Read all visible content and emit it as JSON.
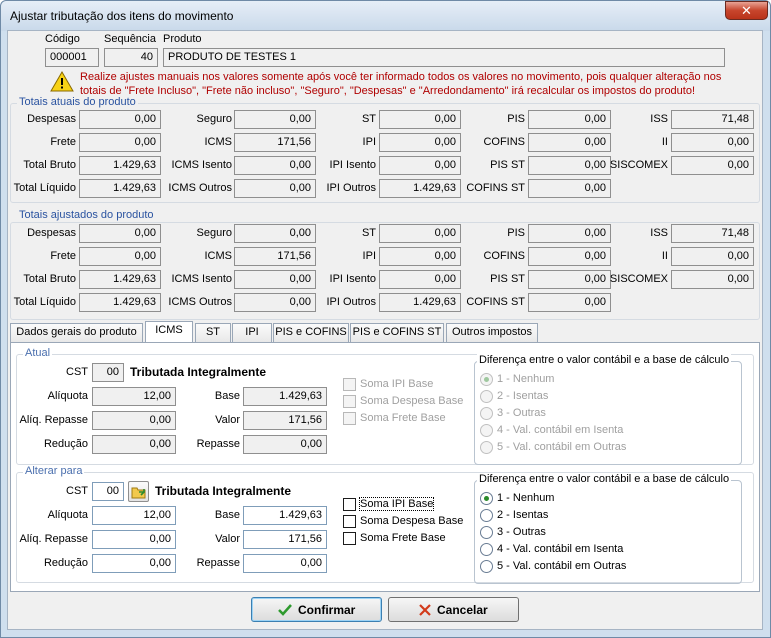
{
  "window": {
    "title": "Ajustar tributação dos itens do movimento",
    "close_glyph": "✕"
  },
  "header": {
    "codigo_label": "Código",
    "codigo_value": "000001",
    "sequencia_label": "Sequência",
    "sequencia_value": "40",
    "produto_label": "Produto",
    "produto_value": "PRODUTO DE TESTES 1"
  },
  "warning": {
    "line1": "Realize ajustes manuais nos valores somente após você ter informado todos os valores no movimento, pois qualquer alteração nos",
    "line2": "totais de  \"Frete Incluso\", \"Frete não incluso\", \"Seguro\", \"Despesas\" e \"Arredondamento\" irá recalcular os impostos do produto!"
  },
  "totais_atuais": {
    "title": "Totais atuais do produto",
    "despesas": {
      "label": "Despesas",
      "value": "0,00"
    },
    "frete": {
      "label": "Frete",
      "value": "0,00"
    },
    "total_bruto": {
      "label": "Total Bruto",
      "value": "1.429,63"
    },
    "total_liquido": {
      "label": "Total Líquido",
      "value": "1.429,63"
    },
    "seguro": {
      "label": "Seguro",
      "value": "0,00"
    },
    "icms": {
      "label": "ICMS",
      "value": "171,56"
    },
    "icms_isento": {
      "label": "ICMS Isento",
      "value": "0,00"
    },
    "icms_outros": {
      "label": "ICMS Outros",
      "value": "0,00"
    },
    "st": {
      "label": "ST",
      "value": "0,00"
    },
    "ipi": {
      "label": "IPI",
      "value": "0,00"
    },
    "ipi_isento": {
      "label": "IPI Isento",
      "value": "0,00"
    },
    "ipi_outros": {
      "label": "IPI Outros",
      "value": "1.429,63"
    },
    "pis": {
      "label": "PIS",
      "value": "0,00"
    },
    "cofins": {
      "label": "COFINS",
      "value": "0,00"
    },
    "pis_st": {
      "label": "PIS ST",
      "value": "0,00"
    },
    "cofins_st": {
      "label": "COFINS ST",
      "value": "0,00"
    },
    "iss": {
      "label": "ISS",
      "value": "71,48"
    },
    "ii": {
      "label": "II",
      "value": "0,00"
    },
    "siscomex": {
      "label": "SISCOMEX",
      "value": "0,00"
    }
  },
  "totais_ajustados": {
    "title": "Totais ajustados do produto",
    "despesas": {
      "label": "Despesas",
      "value": "0,00"
    },
    "frete": {
      "label": "Frete",
      "value": "0,00"
    },
    "total_bruto": {
      "label": "Total Bruto",
      "value": "1.429,63"
    },
    "total_liquido": {
      "label": "Total Líquido",
      "value": "1.429,63"
    },
    "seguro": {
      "label": "Seguro",
      "value": "0,00"
    },
    "icms": {
      "label": "ICMS",
      "value": "171,56"
    },
    "icms_isento": {
      "label": "ICMS Isento",
      "value": "0,00"
    },
    "icms_outros": {
      "label": "ICMS Outros",
      "value": "0,00"
    },
    "st": {
      "label": "ST",
      "value": "0,00"
    },
    "ipi": {
      "label": "IPI",
      "value": "0,00"
    },
    "ipi_isento": {
      "label": "IPI Isento",
      "value": "0,00"
    },
    "ipi_outros": {
      "label": "IPI Outros",
      "value": "1.429,63"
    },
    "pis": {
      "label": "PIS",
      "value": "0,00"
    },
    "cofins": {
      "label": "COFINS",
      "value": "0,00"
    },
    "pis_st": {
      "label": "PIS ST",
      "value": "0,00"
    },
    "cofins_st": {
      "label": "COFINS ST",
      "value": "0,00"
    },
    "iss": {
      "label": "ISS",
      "value": "71,48"
    },
    "ii": {
      "label": "II",
      "value": "0,00"
    },
    "siscomex": {
      "label": "SISCOMEX",
      "value": "0,00"
    }
  },
  "tabs": [
    {
      "label": "Dados gerais do produto"
    },
    {
      "label": "ICMS",
      "active": true
    },
    {
      "label": "ST"
    },
    {
      "label": "IPI"
    },
    {
      "label": "PIS e COFINS"
    },
    {
      "label": "PIS e COFINS ST"
    },
    {
      "label": "Outros impostos"
    }
  ],
  "atual": {
    "title": "Atual",
    "cst_label": "CST",
    "cst_value": "00",
    "cst_desc": "Tributada Integralmente",
    "aliquota": {
      "label": "Alíquota",
      "value": "12,00"
    },
    "aliq_repasse": {
      "label": "Alíq. Repasse",
      "value": "0,00"
    },
    "reducao": {
      "label": "Redução",
      "value": "0,00"
    },
    "base": {
      "label": "Base",
      "value": "1.429,63"
    },
    "valor": {
      "label": "Valor",
      "value": "171,56"
    },
    "repasse": {
      "label": "Repasse",
      "value": "0,00"
    },
    "checks": [
      "Soma IPI Base",
      "Soma Despesa Base",
      "Soma Frete Base"
    ],
    "diff_title": "Diferença entre o valor contábil e a base de cálculo",
    "diff_options": [
      "1 - Nenhum",
      "2 - Isentas",
      "3 - Outras",
      "4 - Val. contábil em Isenta",
      "5 - Val. contábil em Outras"
    ],
    "diff_selected": 0
  },
  "alterar": {
    "title": "Alterar para",
    "cst_label": "CST",
    "cst_value": "00",
    "cst_desc": "Tributada Integralmente",
    "aliquota": {
      "label": "Alíquota",
      "value": "12,00"
    },
    "aliq_repasse": {
      "label": "Alíq. Repasse",
      "value": "0,00"
    },
    "reducao": {
      "label": "Redução",
      "value": "0,00"
    },
    "base": {
      "label": "Base",
      "value": "1.429,63"
    },
    "valor": {
      "label": "Valor",
      "value": "171,56"
    },
    "repasse": {
      "label": "Repasse",
      "value": "0,00"
    },
    "checks": [
      "Soma IPI Base",
      "Soma Despesa Base",
      "Soma Frete Base"
    ],
    "diff_title": "Diferença entre o valor contábil e a base de cálculo",
    "diff_options": [
      "1 - Nenhum",
      "2 - Isentas",
      "3 - Outras",
      "4 - Val. contábil em Isenta",
      "5 - Val. contábil em Outras"
    ],
    "diff_selected": 0
  },
  "buttons": {
    "confirmar": {
      "label": "Confirmar",
      "icon": "check-icon",
      "color": "#2e9a2e"
    },
    "cancelar": {
      "label": "Cancelar",
      "icon": "x-icon",
      "color": "#d23a1a"
    }
  }
}
